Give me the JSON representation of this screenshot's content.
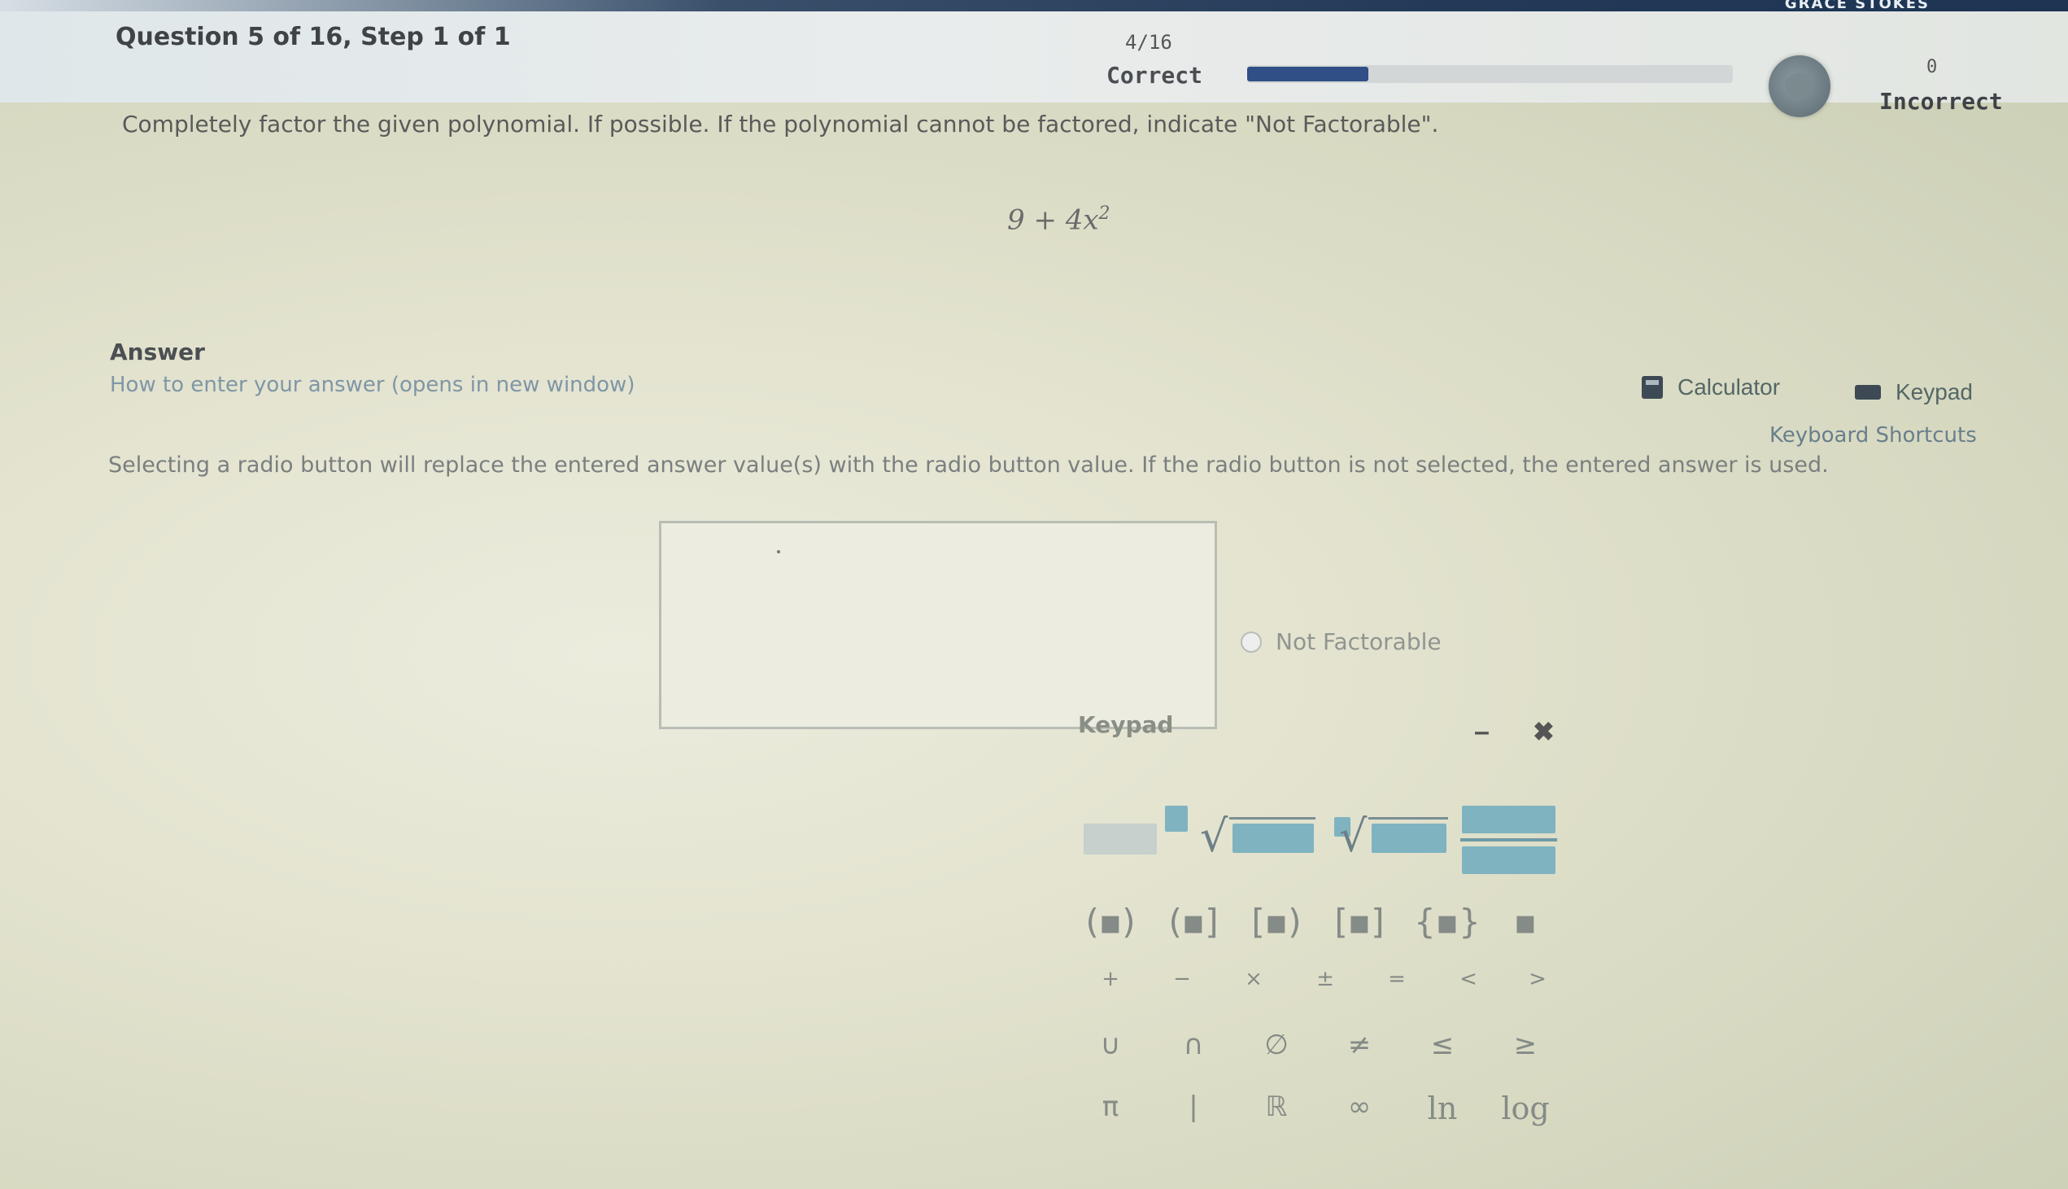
{
  "topbar": {
    "text": "GRACE STOKES"
  },
  "header": {
    "question_title": "Question 5 of 16,  Step 1 of 1",
    "score_fraction": "4/16",
    "correct_label": "Correct",
    "progress_fraction": 0.25,
    "incorrect_count": "0",
    "incorrect_label": "Incorrect"
  },
  "problem": {
    "instructions": "Completely factor the given polynomial. If possible. If the polynomial cannot be factored, indicate \"Not Factorable\".",
    "expression_base": "9 + 4x",
    "expression_exponent": "2"
  },
  "answer": {
    "heading": "Answer",
    "how_to_link": "How to enter your answer (opens in new window)",
    "calculator_label": "Calculator",
    "keypad_label": "Keypad",
    "shortcuts_label": "Keyboard Shortcuts",
    "radio_note": "Selecting a radio button will replace the entered answer value(s) with the radio button value. If the radio button is not selected, the entered answer is used.",
    "radio_option": "Not Factorable"
  },
  "keypad": {
    "title": "Keypad",
    "minimize": "–",
    "close": "✖",
    "row2": [
      "(▪)",
      "(▪]",
      "[▪)",
      "[▪]",
      "{▪}",
      "▪"
    ],
    "row3": [
      "+",
      "−",
      "×",
      "±",
      "=",
      "<",
      ">"
    ],
    "row4": [
      "∪",
      "∩",
      "∅",
      "≠",
      "≤",
      "≥"
    ],
    "row5": [
      "π",
      "|",
      "ℝ",
      "∞",
      "ln",
      "log"
    ]
  }
}
